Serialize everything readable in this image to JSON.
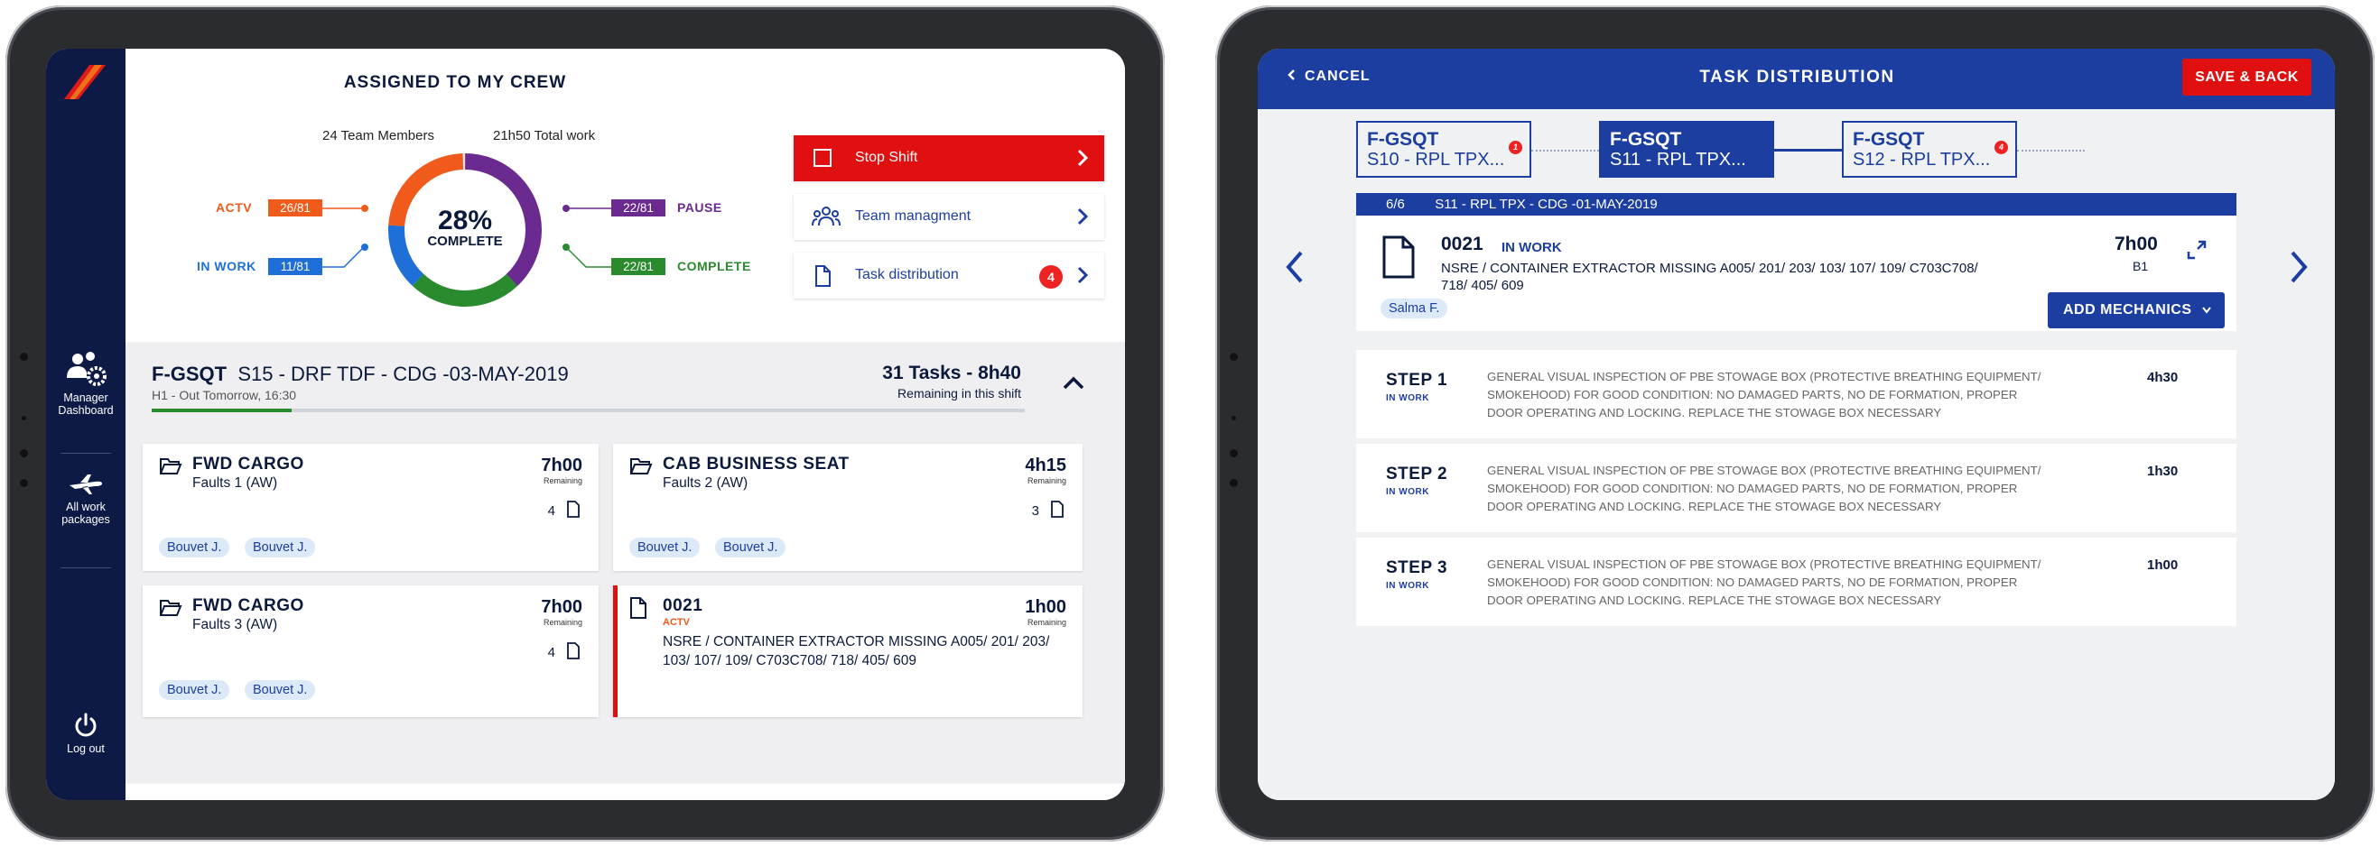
{
  "left": {
    "title": "ASSIGNED TO MY CREW",
    "team_members": "24 Team Members",
    "total_work": "21h50 Total work",
    "stats": {
      "actv_label": "ACTV",
      "actv_value": "26/81",
      "inwork_label": "IN WORK",
      "inwork_value": "11/81",
      "pause_label": "PAUSE",
      "pause_value": "22/81",
      "complete_label": "COMPLETE",
      "complete_value": "22/81"
    },
    "donut": {
      "percent": "28%",
      "label": "COMPLETE"
    },
    "buttons": {
      "stop_shift": "Stop Shift",
      "team": "Team managment",
      "task": "Task distribution",
      "task_badge": "4"
    },
    "sidebar": {
      "manager": "Manager Dashboard",
      "packages": "All work packages",
      "logout": "Log out"
    },
    "package": {
      "registration": "F-GSQT",
      "name": "S15 - DRF TDF - CDG -03-MAY-2019",
      "sub": "H1 - Out Tomorrow, 16:30",
      "progress": 0.16,
      "tasks": "31 Tasks - 8h40",
      "remaining": "Remaining in this shift"
    },
    "cards": [
      {
        "title": "FWD CARGO",
        "sub": "Faults 1 (AW)",
        "hours": "7h00",
        "rem": "Remaining",
        "count": "4",
        "chips": [
          "Bouvet J.",
          "Bouvet J."
        ]
      },
      {
        "title": "CAB BUSINESS SEAT",
        "sub": "Faults 2 (AW)",
        "hours": "4h15",
        "rem": "Remaining",
        "count": "3",
        "chips": [
          "Bouvet J.",
          "Bouvet J."
        ]
      },
      {
        "title": "FWD CARGO",
        "sub": "Faults 3 (AW)",
        "hours": "7h00",
        "rem": "Remaining",
        "count": "4",
        "chips": [
          "Bouvet J.",
          "Bouvet J."
        ]
      },
      {
        "title": "0021",
        "status": "ACTV",
        "desc": "NSRE / CONTAINER EXTRACTOR MISSING A005/ 201/ 203/ 103/ 107/ 109/ C703C708/ 718/ 405/ 609",
        "hours": "1h00",
        "rem": "Remaining"
      }
    ]
  },
  "right": {
    "cancel": "CANCEL",
    "title": "TASK DISTRIBUTION",
    "save": "SAVE & BACK",
    "tabs": [
      {
        "reg": "F-GSQT",
        "name": "S10 - RPL TPX...",
        "badge": "1"
      },
      {
        "reg": "F-GSQT",
        "name": "S11 - RPL TPX..."
      },
      {
        "reg": "F-GSQT",
        "name": "S12 - RPL TPX...",
        "badge": "4"
      }
    ],
    "bar": "6/6        S11 - RPL TPX - CDG -01-MAY-2019",
    "task": {
      "id": "0021",
      "status": "IN WORK",
      "desc": "NSRE / CONTAINER EXTRACTOR MISSING A005/ 201/ 203/ 103/ 107/ 109/ C703C708/ 718/ 405/ 609",
      "hours": "7h00",
      "level": "B1",
      "chip": "Salma F.",
      "add": "ADD MECHANICS"
    },
    "steps": [
      {
        "name": "STEP 1",
        "status": "IN WORK",
        "time": "4h30",
        "desc": "GENERAL VISUAL INSPECTION OF PBE STOWAGE BOX (PROTECTIVE BREATHING EQUIPMENT/ SMOKEHOOD) FOR GOOD CONDITION: NO DAMAGED PARTS, NO DE FORMATION, PROPER DOOR OPERATING AND LOCKING. REPLACE THE STOWAGE BOX NECESSARY"
      },
      {
        "name": "STEP 2",
        "status": "IN WORK",
        "time": "1h30",
        "desc": "GENERAL VISUAL INSPECTION OF PBE STOWAGE BOX (PROTECTIVE BREATHING EQUIPMENT/ SMOKEHOOD) FOR GOOD CONDITION: NO DAMAGED PARTS, NO DE FORMATION, PROPER DOOR OPERATING AND LOCKING. REPLACE THE STOWAGE BOX NECESSARY"
      },
      {
        "name": "STEP 3",
        "status": "IN WORK",
        "time": "1h00",
        "desc": "GENERAL VISUAL INSPECTION OF PBE STOWAGE BOX (PROTECTIVE BREATHING EQUIPMENT/ SMOKEHOOD) FOR GOOD CONDITION: NO DAMAGED PARTS, NO DE FORMATION, PROPER DOOR OPERATING AND LOCKING. REPLACE THE STOWAGE BOX NECESSARY"
      }
    ]
  },
  "colors": {
    "navy": "#0e1a46",
    "blue": "#1b3ea0",
    "red": "#e01010",
    "orange": "#f05a1a",
    "purple": "#6a2a90",
    "green": "#2a8a2e",
    "lightblue": "#1f6fd8"
  }
}
